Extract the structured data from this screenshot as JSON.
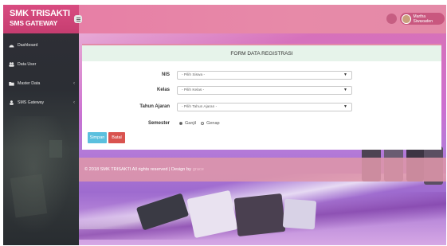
{
  "brand": {
    "title": "SMK TRISAKTI",
    "subtitle": "SMS GATEWAY"
  },
  "sidebar": {
    "items": [
      {
        "label": "Dashboard",
        "icon": "dashboard-icon",
        "has_caret": false
      },
      {
        "label": "Data User",
        "icon": "users-icon",
        "has_caret": false
      },
      {
        "label": "Master Data",
        "icon": "folder-icon",
        "has_caret": true
      },
      {
        "label": "SMS Gateway",
        "icon": "user-icon",
        "has_caret": true
      }
    ],
    "caret": "‹"
  },
  "topbar": {
    "user_name": "Martha Siwaxaden"
  },
  "form": {
    "title": "FORM DATA REGISTRASI",
    "fields": [
      {
        "label": "NIS",
        "placeholder": "- Pilih Siswa -"
      },
      {
        "label": "Kelas",
        "placeholder": "- Pilih Kelas -"
      },
      {
        "label": "Tahun Ajaran",
        "placeholder": "- Pilih Tahun Ajaran -"
      }
    ],
    "semester": {
      "label": "Semester",
      "options": [
        "Ganjil",
        "Genap"
      ],
      "selected": "Ganjil"
    },
    "buttons": {
      "save": "Simpan",
      "reset": "Batal"
    }
  },
  "footer": {
    "text": "© 2018 SMK TRISAKTI All rights reserved | Design by",
    "credit": "grace"
  },
  "colors": {
    "accent": "#e28ba8",
    "sidebar": "#2f2f36",
    "save": "#5bc0de",
    "reset": "#d9534f"
  }
}
